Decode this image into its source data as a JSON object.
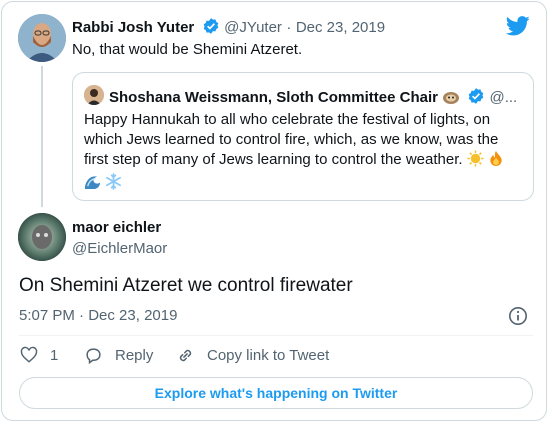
{
  "reply_tweet": {
    "author_name": "Rabbi Josh Yuter",
    "author_handle": "@JYuter",
    "separator": "·",
    "date": "Dec 23, 2019",
    "text": "No, that would be Shemini Atzeret."
  },
  "quoted_tweet": {
    "author_name": "Shoshana Weissmann, Sloth Committee Chair",
    "author_handle": "@...",
    "text": "Happy Hannukah to all who celebrate the festival of lights, on which Jews learned to control fire, which, as we know, was the first step of many of Jews learning to control the weather."
  },
  "main_tweet": {
    "author_name": "maor eichler",
    "author_handle": "@EichlerMaor",
    "text": "On Shemini Atzeret we control firewater",
    "time": "5:07 PM",
    "separator": "·",
    "date": "Dec 23, 2019"
  },
  "actions": {
    "like_count": "1",
    "reply_label": "Reply",
    "copy_link_label": "Copy link to Tweet"
  },
  "explore_label": "Explore what's happening on Twitter",
  "colors": {
    "accent": "#1d9bf0",
    "muted": "#536471",
    "border": "#cfd9de"
  }
}
